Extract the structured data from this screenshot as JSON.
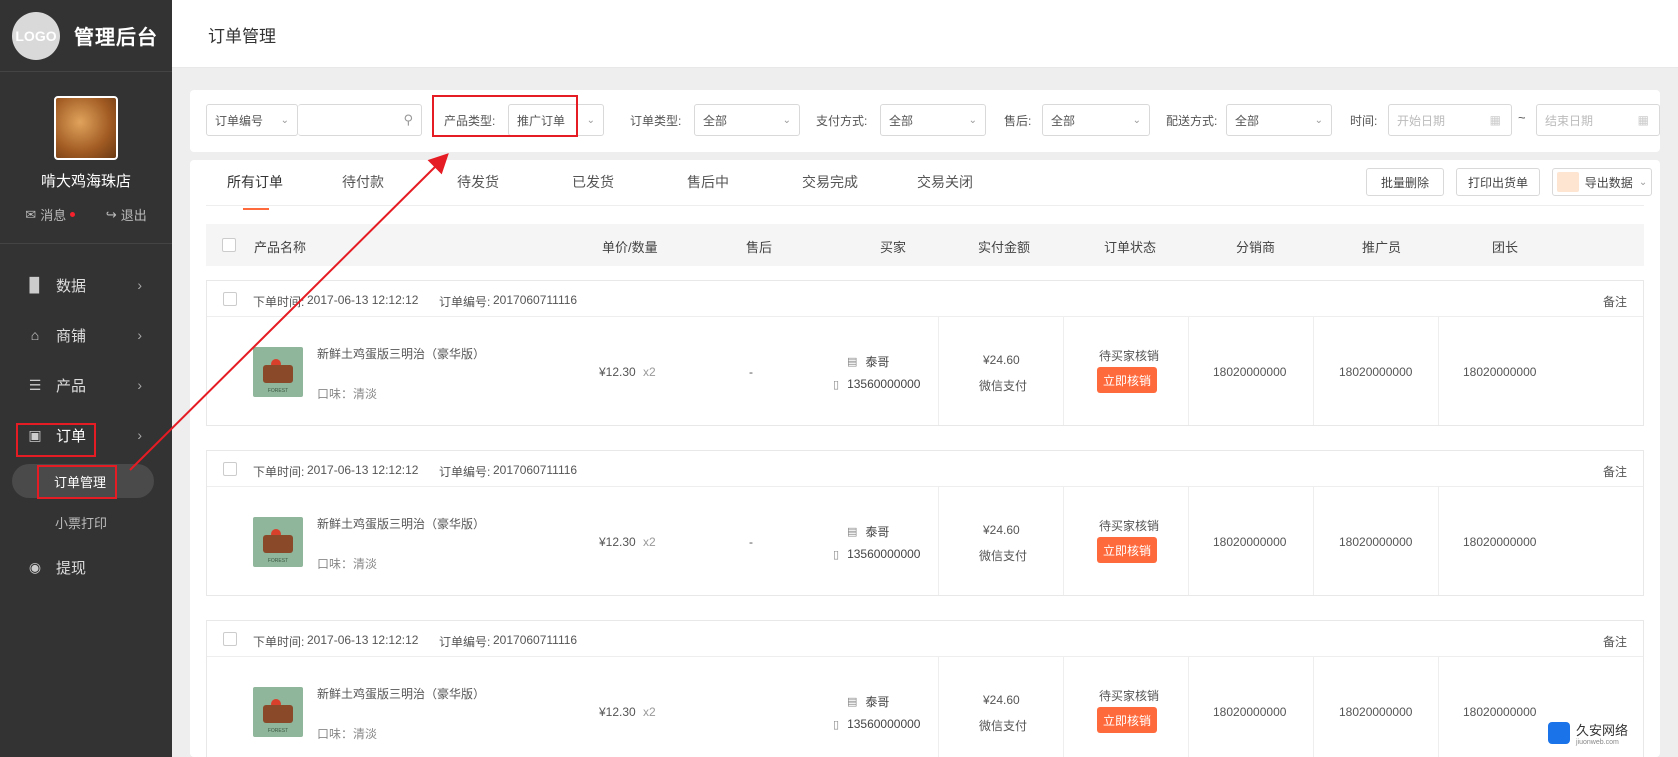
{
  "sidebar": {
    "logo": "LOGO",
    "app_title": "管理后台",
    "shop_name": "啃大鸡海珠店",
    "messages_label": "消息",
    "logout_label": "退出",
    "nav": [
      {
        "label": "数据",
        "icon": "bar-chart-icon"
      },
      {
        "label": "商铺",
        "icon": "home-icon"
      },
      {
        "label": "产品",
        "icon": "layers-icon"
      },
      {
        "label": "订单",
        "icon": "clipboard-icon"
      },
      {
        "label": "提现",
        "icon": "wallet-icon"
      }
    ],
    "sub_nav": [
      {
        "label": "订单管理"
      },
      {
        "label": "小票打印"
      }
    ]
  },
  "header": {
    "title": "订单管理"
  },
  "filters": {
    "order_no_select": "订单编号",
    "product_type_label": "产品类型:",
    "product_type_value": "推广订单",
    "order_type_label": "订单类型:",
    "order_type_value": "全部",
    "pay_method_label": "支付方式:",
    "pay_method_value": "全部",
    "after_sale_label": "售后:",
    "after_sale_value": "全部",
    "delivery_label": "配送方式:",
    "delivery_value": "全部",
    "time_label": "时间:",
    "start_placeholder": "开始日期",
    "end_placeholder": "结束日期",
    "tilde": "~"
  },
  "tabs": [
    {
      "label": "所有订单"
    },
    {
      "label": "待付款"
    },
    {
      "label": "待发货"
    },
    {
      "label": "已发货"
    },
    {
      "label": "售后中"
    },
    {
      "label": "交易完成"
    },
    {
      "label": "交易关闭"
    }
  ],
  "toolbar": {
    "batch_delete": "批量删除",
    "print_shipping": "打印出货单",
    "export": "导出数据"
  },
  "table": {
    "headers": [
      "产品名称",
      "单价/数量",
      "售后",
      "买家",
      "实付金额",
      "订单状态",
      "分销商",
      "推广员",
      "团长"
    ]
  },
  "orders": [
    {
      "time_label": "下单时间:",
      "time": "2017-06-13 12:12:12",
      "no_label": "订单编号:",
      "no": "2017060711116",
      "remark": "备注",
      "product_name": "新鲜土鸡蛋版三明治（豪华版）",
      "flavor": "口味：清淡",
      "img_brand": "FOREST",
      "price": "¥12.30",
      "qty": "x2",
      "after_sale": "-",
      "buyer_name": "泰哥",
      "buyer_phone": "13560000000",
      "amount": "¥24.60",
      "pay_method": "微信支付",
      "status": "待买家核销",
      "action": "立即核销",
      "distributor": "18020000000",
      "promoter": "18020000000",
      "leader": "18020000000"
    },
    {
      "time_label": "下单时间:",
      "time": "2017-06-13 12:12:12",
      "no_label": "订单编号:",
      "no": "2017060711116",
      "remark": "备注",
      "product_name": "新鲜土鸡蛋版三明治（豪华版）",
      "flavor": "口味：清淡",
      "img_brand": "FOREST",
      "price": "¥12.30",
      "qty": "x2",
      "after_sale": "-",
      "buyer_name": "泰哥",
      "buyer_phone": "13560000000",
      "amount": "¥24.60",
      "pay_method": "微信支付",
      "status": "待买家核销",
      "action": "立即核销",
      "distributor": "18020000000",
      "promoter": "18020000000",
      "leader": "18020000000"
    },
    {
      "time_label": "下单时间:",
      "time": "2017-06-13 12:12:12",
      "no_label": "订单编号:",
      "no": "2017060711116",
      "remark": "备注",
      "product_name": "新鲜土鸡蛋版三明治（豪华版）",
      "flavor": "口味：清淡",
      "img_brand": "FOREST",
      "price": "¥12.30",
      "qty": "x2",
      "buyer_name": "泰哥",
      "buyer_phone": "13560000000",
      "amount": "¥24.60",
      "pay_method": "微信支付",
      "status": "待买家核销",
      "action": "立即核销",
      "distributor": "18020000000",
      "promoter": "18020000000",
      "leader": "18020000000"
    }
  ],
  "watermark": {
    "name": "久安网络",
    "url": "jiuonweb.com"
  },
  "colors": {
    "sidebar": "#333333",
    "accent": "#ff6a3d",
    "annotation": "#e51c23"
  }
}
